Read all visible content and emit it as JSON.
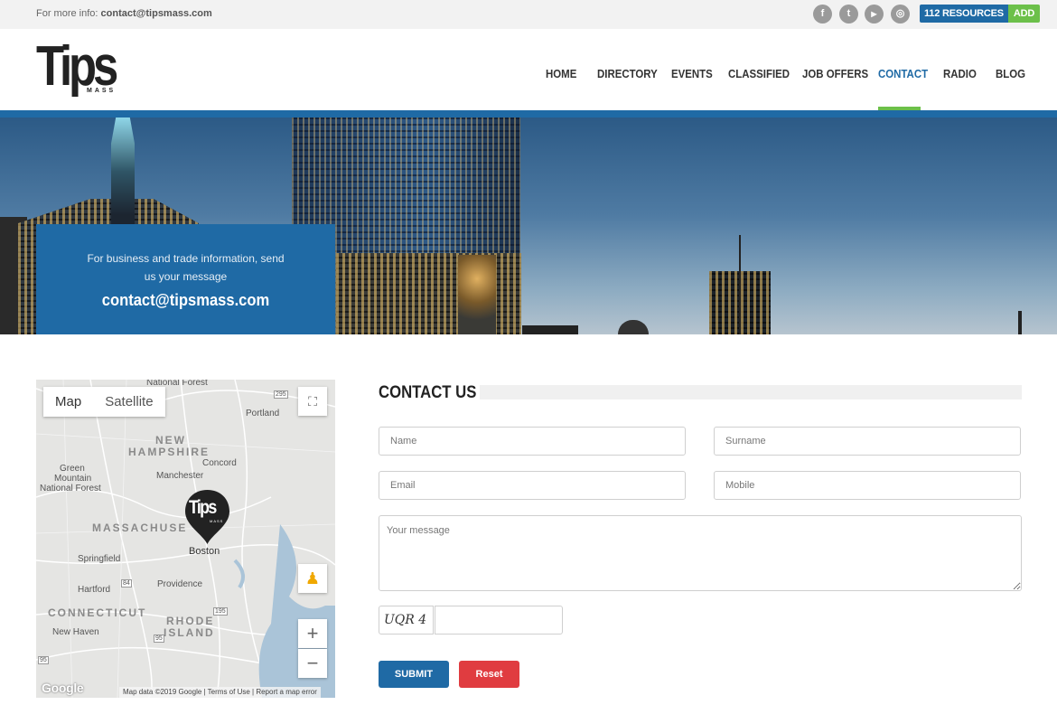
{
  "topbar": {
    "info_prefix": "For more info: ",
    "info_email": "contact@tipsmass.com",
    "social": [
      {
        "icon": "facebook-icon",
        "glyph": "f"
      },
      {
        "icon": "twitter-icon",
        "glyph": "t"
      },
      {
        "icon": "youtube-icon",
        "glyph": "▶"
      },
      {
        "icon": "instagram-icon",
        "glyph": "◎"
      }
    ],
    "resources_label": "112 RESOURCES",
    "add_label": "ADD"
  },
  "header": {
    "logo_text": "Tips",
    "logo_sub": "MASS",
    "nav": [
      "HOME",
      "DIRECTORY",
      "EVENTS",
      "CLASSIFIED",
      "JOB OFFERS",
      "CONTACT",
      "RADIO",
      "BLOG"
    ],
    "active_nav": "CONTACT"
  },
  "hero": {
    "text": "For business and trade information, send us your message",
    "email": "contact@tipsmass.com"
  },
  "map": {
    "type_map": "Map",
    "type_satellite": "Satellite",
    "labels": [
      "National Forest",
      "Portland",
      "NEW",
      "HAMPSHIRE",
      "Concord",
      "Green",
      "Mountain",
      "National Forest",
      "Manchester",
      "MASSACHUSE",
      "Boston",
      "Springfield",
      "Providence",
      "Hartford",
      "CONNECTICUT",
      "RHODE",
      "ISLAND",
      "New Haven",
      "295",
      "95",
      "84",
      "95",
      "195"
    ],
    "pin_text": "Tips",
    "pin_sub": "MASS",
    "google": "Google",
    "footer": "Map data ©2019 Google  |  Terms of Use  |  Report a map error",
    "zoom_in": "+",
    "zoom_out": "−"
  },
  "contact": {
    "title": "CONTACT US",
    "name_placeholder": "Name",
    "surname_placeholder": "Surname",
    "email_placeholder": "Email",
    "mobile_placeholder": "Mobile",
    "message_placeholder": "Your message",
    "captcha": "UQR 4",
    "submit": "SUBMIT",
    "reset": "Reset"
  },
  "colors": {
    "brand_blue": "#1f6aa5",
    "brand_green": "#6cc04a",
    "reset_red": "#e03c40"
  }
}
